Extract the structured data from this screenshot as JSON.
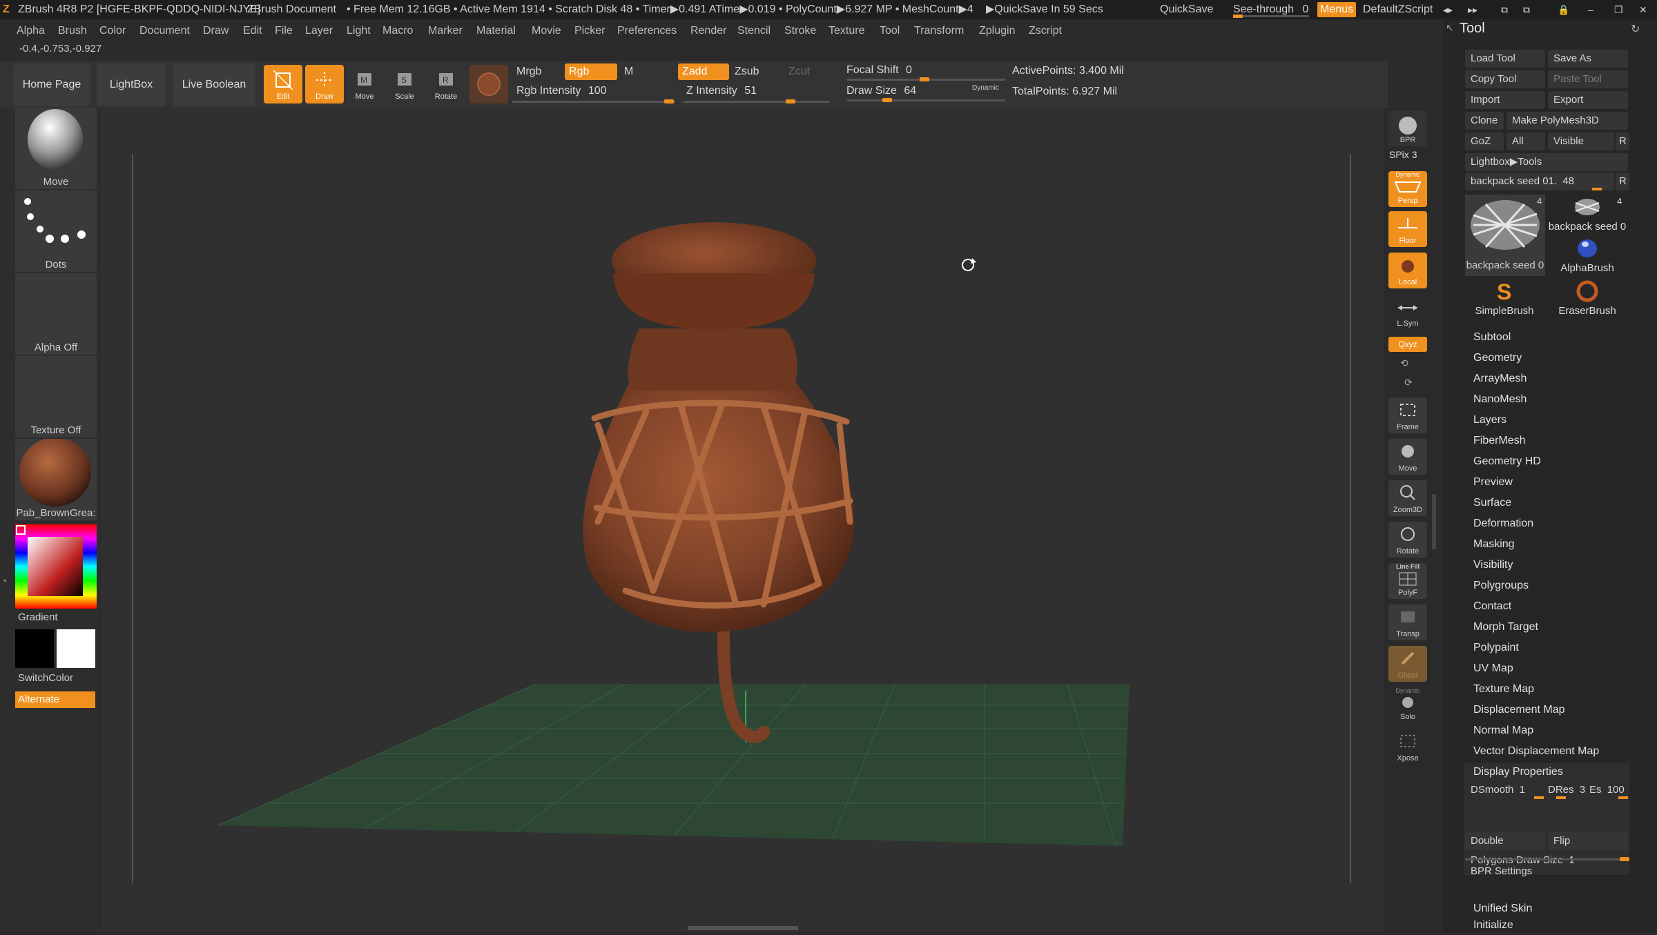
{
  "titlebar": {
    "app": "ZBrush 4R8 P2 [HGFE-BKPF-QDDQ-NIDI-NJYE]",
    "document": "ZBrush Document",
    "stats": "• Free Mem 12.16GB • Active Mem 1914 • Scratch Disk 48 • Timer▶0.491 ATime▶0.019 • PolyCount▶6.927 MP • MeshCount▶4",
    "quicksave_timer": "▶QuickSave In 59 Secs",
    "quicksave": "QuickSave",
    "see_through_label": "See-through",
    "see_through_value": "0",
    "menus": "Menus",
    "script": "DefaultZScript"
  },
  "menubar": [
    "Alpha",
    "Brush",
    "Color",
    "Document",
    "Draw",
    "Edit",
    "File",
    "Layer",
    "Light",
    "Macro",
    "Marker",
    "Material",
    "Movie",
    "Picker",
    "Preferences",
    "Render",
    "Stencil",
    "Stroke",
    "Texture",
    "Tool",
    "Transform",
    "Zplugin",
    "Zscript"
  ],
  "coords": "-0.4,-0.753,-0.927",
  "shelf": {
    "home_page": "Home Page",
    "lightbox": "LightBox",
    "live_boolean": "Live Boolean",
    "edit": "Edit",
    "draw": "Draw",
    "move": "Move",
    "scale": "Scale",
    "rotate": "Rotate",
    "mrgb": "Mrgb",
    "rgb": "Rgb",
    "m": "M",
    "zadd": "Zadd",
    "zsub": "Zsub",
    "zcut": "Zcut",
    "rgb_intensity_label": "Rgb Intensity",
    "rgb_intensity": "100",
    "z_intensity_label": "Z Intensity",
    "z_intensity": "51",
    "focal_shift_label": "Focal Shift",
    "focal_shift": "0",
    "draw_size_label": "Draw Size",
    "draw_size": "64",
    "dynamic": "Dynamic",
    "active_points": "ActivePoints: 3.400 Mil",
    "total_points": "TotalPoints: 6.927 Mil"
  },
  "left": {
    "brush": "Move",
    "stroke": "Dots",
    "alpha": "Alpha Off",
    "texture": "Texture Off",
    "material": "Pab_BrownGrea:",
    "gradient": "Gradient",
    "switchcolor": "SwitchColor",
    "alternate": "Alternate"
  },
  "right": {
    "bpr": "BPR",
    "spix_label": "SPix",
    "spix": "3",
    "dynamic": "Dynamic",
    "persp": "Persp",
    "floor": "Floor",
    "local": "Local",
    "lsym": "L.Sym",
    "xyz": "Qxyz",
    "frame": "Frame",
    "move": "Move",
    "zoom3d": "Zoom3D",
    "rotate": "Rotate",
    "line_fill": "Line Fill",
    "polyf": "PolyF",
    "transp": "Transp",
    "ghost": "Ghost",
    "dynamic2": "Dynamic",
    "solo": "Solo",
    "xpose": "Xpose"
  },
  "tool": {
    "title": "Tool",
    "load_tool": "Load Tool",
    "save_as": "Save As",
    "copy_tool": "Copy Tool",
    "paste_tool": "Paste Tool",
    "import": "Import",
    "export": "Export",
    "clone": "Clone",
    "make_polymesh": "Make PolyMesh3D",
    "goz": "GoZ",
    "all": "All",
    "visible": "Visible",
    "r": "R",
    "lightbox_tools": "Lightbox▶Tools",
    "current_tool_label": "backpack seed 01.",
    "current_tool_value": "48",
    "thumbs": [
      {
        "name": "backpack seed 0",
        "count": "4"
      },
      {
        "name": "backpack seed 0",
        "count": "4"
      },
      {
        "name": "AlphaBrush",
        "count": ""
      },
      {
        "name": "SimpleBrush",
        "count": ""
      },
      {
        "name": "EraserBrush",
        "count": ""
      }
    ],
    "sections": [
      "Subtool",
      "Geometry",
      "ArrayMesh",
      "NanoMesh",
      "Layers",
      "FiberMesh",
      "Geometry HD",
      "Preview",
      "Surface",
      "Deformation",
      "Masking",
      "Visibility",
      "Polygroups",
      "Contact",
      "Morph Target",
      "Polypaint",
      "UV Map",
      "Texture Map",
      "Displacement Map",
      "Normal Map",
      "Vector Displacement Map",
      "Display Properties"
    ],
    "dsmooth_label": "DSmooth",
    "dsmooth": "1",
    "dres_label": "DRes",
    "dres": "3",
    "es_label": "Es",
    "es": "100",
    "double": "Double",
    "flip": "Flip",
    "polygons_draw_size_label": "Polygons Draw Size",
    "polygons_draw_size": "1",
    "bpr_settings": "BPR Settings",
    "unified_skin": "Unified Skin",
    "initialize": "Initialize"
  },
  "colors": {
    "accent": "#f0901e",
    "model": "#8b4a2c",
    "grid": "#2f5a3a"
  }
}
